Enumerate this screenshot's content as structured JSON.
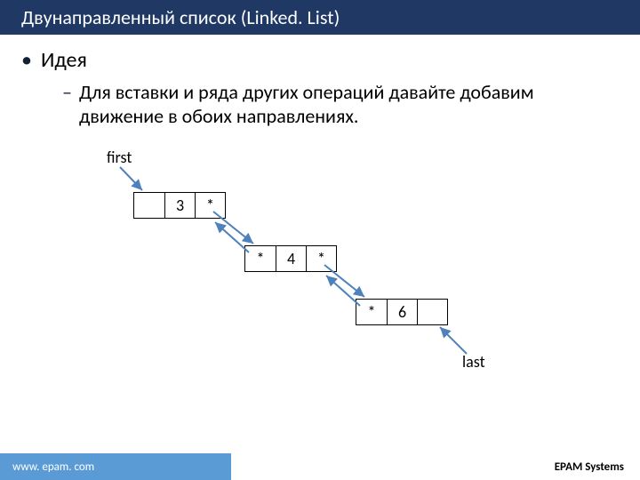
{
  "title": "Двунаправленный список (Linked. List)",
  "idea_label": "Идея",
  "idea_text": "Для вставки и ряда других операций давайте добавим движение в обоих направлениях.",
  "diagram": {
    "first_label": "first",
    "last_label": "last",
    "ptr": "*",
    "nodes": [
      {
        "prev": "",
        "val": "3",
        "next": "*"
      },
      {
        "prev": "*",
        "val": "4",
        "next": "*"
      },
      {
        "prev": "*",
        "val": "6",
        "next": ""
      }
    ]
  },
  "footer": {
    "url": "www. epam. com",
    "brand": "EPAM Systems"
  },
  "colors": {
    "header_bg": "#1f3864",
    "footer_left_bg": "#5b9bd5",
    "arrow": "#4f81bd"
  }
}
